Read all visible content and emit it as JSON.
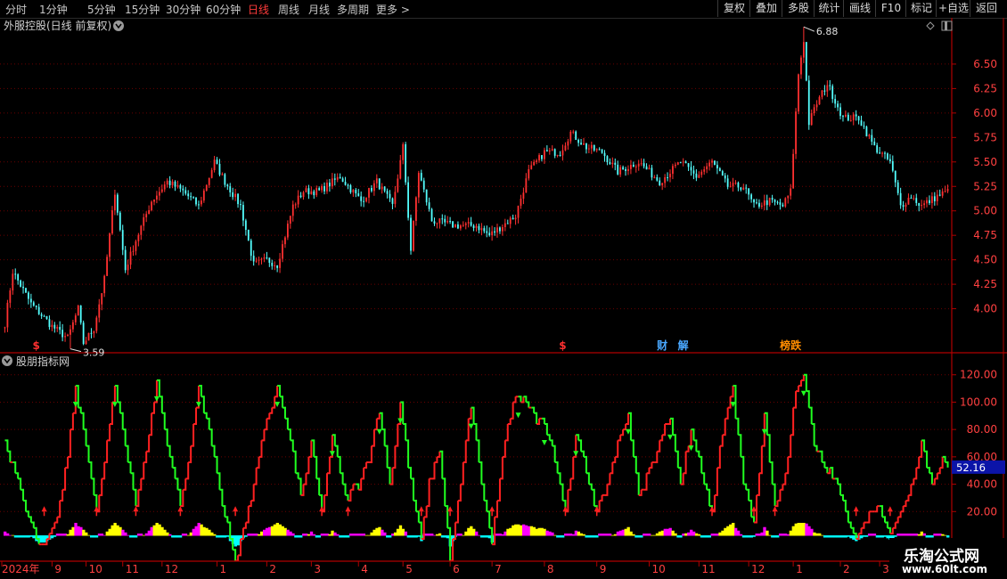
{
  "toolbar": {
    "periods": [
      "分时",
      "1分钟",
      "5分钟",
      "15分钟",
      "30分钟",
      "60分钟",
      "日线",
      "周线",
      "月线",
      "多周期",
      "更多"
    ],
    "active_period": "日线",
    "tools": [
      "复权",
      "叠加",
      "多股",
      "统计",
      "画线",
      "F10",
      "标记",
      "+自选",
      "返回"
    ]
  },
  "main_panel": {
    "title": "外服控股(日线 前复权)",
    "high_label": "6.88",
    "low_label": "3.59",
    "event_tags": [
      {
        "text": "$",
        "color": "#ff3030",
        "bar": 12
      },
      {
        "text": "$",
        "color": "#ff3030",
        "bar": 213
      },
      {
        "text": "财",
        "color": "#4aa8ff",
        "bar": 251
      },
      {
        "text": "解",
        "color": "#4aa8ff",
        "bar": 259
      },
      {
        "text": "榜跌",
        "color": "#ff8c00",
        "bar": 300
      }
    ]
  },
  "indicator_panel": {
    "title": "股朋指标网",
    "current_value": "52.16"
  },
  "date_axis": [
    "2024年",
    "9",
    "10",
    "11",
    "12",
    "1",
    "2",
    "3",
    "4",
    "5",
    "6",
    "7",
    "8",
    "9",
    "10",
    "11",
    "12",
    "1",
    "2",
    "3"
  ],
  "watermark": {
    "line1": "乐淘公式网",
    "line2": "www.60lt.com"
  },
  "colors": {
    "up": "#ff3030",
    "down": "#54ffff",
    "grid": "#6a0000",
    "axis": "#b00000",
    "ind_up": "#ff2020",
    "ind_down": "#20ff20",
    "hist_yellow": "#ffff00",
    "hist_magenta": "#ff00ff",
    "hist_cyan": "#00ffff"
  },
  "chart_data": [
    {
      "type": "candlestick",
      "title": "外服控股(日线 前复权)",
      "y_ticks": [
        4.0,
        4.25,
        4.5,
        4.75,
        5.0,
        5.25,
        5.5,
        5.75,
        6.0,
        6.25,
        6.5
      ],
      "ylim": [
        3.55,
        6.95
      ],
      "anchors": [
        {
          "bar": 0,
          "close": 3.85
        },
        {
          "bar": 3,
          "close": 4.38
        },
        {
          "bar": 10,
          "close": 4.05
        },
        {
          "bar": 18,
          "close": 3.82
        },
        {
          "bar": 24,
          "close": 3.7
        },
        {
          "bar": 28,
          "close": 4.0
        },
        {
          "bar": 30,
          "close": 3.65
        },
        {
          "bar": 34,
          "close": 3.8
        },
        {
          "bar": 38,
          "close": 4.3
        },
        {
          "bar": 42,
          "close": 5.2
        },
        {
          "bar": 46,
          "close": 4.4
        },
        {
          "bar": 50,
          "close": 4.7
        },
        {
          "bar": 56,
          "close": 5.1
        },
        {
          "bar": 62,
          "close": 5.3
        },
        {
          "bar": 68,
          "close": 5.2
        },
        {
          "bar": 74,
          "close": 5.05
        },
        {
          "bar": 80,
          "close": 5.5
        },
        {
          "bar": 84,
          "close": 5.3
        },
        {
          "bar": 90,
          "close": 5.05
        },
        {
          "bar": 95,
          "close": 4.45
        },
        {
          "bar": 100,
          "close": 4.5
        },
        {
          "bar": 104,
          "close": 4.45
        },
        {
          "bar": 110,
          "close": 5.05
        },
        {
          "bar": 114,
          "close": 5.2
        },
        {
          "bar": 120,
          "close": 5.2
        },
        {
          "bar": 128,
          "close": 5.35
        },
        {
          "bar": 136,
          "close": 5.1
        },
        {
          "bar": 142,
          "close": 5.3
        },
        {
          "bar": 148,
          "close": 5.05
        },
        {
          "bar": 152,
          "close": 5.65
        },
        {
          "bar": 155,
          "close": 4.6
        },
        {
          "bar": 158,
          "close": 5.4
        },
        {
          "bar": 163,
          "close": 4.9
        },
        {
          "bar": 172,
          "close": 4.85
        },
        {
          "bar": 180,
          "close": 4.85
        },
        {
          "bar": 185,
          "close": 4.75
        },
        {
          "bar": 190,
          "close": 4.85
        },
        {
          "bar": 195,
          "close": 4.95
        },
        {
          "bar": 200,
          "close": 5.4
        },
        {
          "bar": 206,
          "close": 5.6
        },
        {
          "bar": 212,
          "close": 5.6
        },
        {
          "bar": 216,
          "close": 5.8
        },
        {
          "bar": 222,
          "close": 5.65
        },
        {
          "bar": 228,
          "close": 5.6
        },
        {
          "bar": 234,
          "close": 5.4
        },
        {
          "bar": 242,
          "close": 5.5
        },
        {
          "bar": 250,
          "close": 5.3
        },
        {
          "bar": 258,
          "close": 5.5
        },
        {
          "bar": 264,
          "close": 5.35
        },
        {
          "bar": 270,
          "close": 5.5
        },
        {
          "bar": 276,
          "close": 5.25
        },
        {
          "bar": 282,
          "close": 5.25
        },
        {
          "bar": 286,
          "close": 5.05
        },
        {
          "bar": 292,
          "close": 5.1
        },
        {
          "bar": 297,
          "close": 5.05
        },
        {
          "bar": 300,
          "close": 5.2
        },
        {
          "bar": 303,
          "close": 6.4
        },
        {
          "bar": 305,
          "close": 6.75
        },
        {
          "bar": 307,
          "close": 5.9
        },
        {
          "bar": 310,
          "close": 6.1
        },
        {
          "bar": 314,
          "close": 6.3
        },
        {
          "bar": 320,
          "close": 5.95
        },
        {
          "bar": 326,
          "close": 5.95
        },
        {
          "bar": 332,
          "close": 5.65
        },
        {
          "bar": 338,
          "close": 5.5
        },
        {
          "bar": 342,
          "close": 5.05
        },
        {
          "bar": 346,
          "close": 5.15
        },
        {
          "bar": 350,
          "close": 5.05
        },
        {
          "bar": 356,
          "close": 5.15
        },
        {
          "bar": 360,
          "close": 5.2
        }
      ]
    },
    {
      "type": "line",
      "title": "股朋指标网",
      "y_ticks": [
        20,
        40,
        60,
        80,
        100,
        120
      ],
      "ylim": [
        -15,
        127
      ],
      "current": 52.16,
      "series": [
        {
          "color": "main-oscillator",
          "anchors": [
            {
              "bar": 0,
              "value": 70
            },
            {
              "bar": 5,
              "value": 45
            },
            {
              "bar": 9,
              "value": 15
            },
            {
              "bar": 12,
              "value": 0
            },
            {
              "bar": 16,
              "value": -3
            },
            {
              "bar": 20,
              "value": 15
            },
            {
              "bar": 24,
              "value": 60
            },
            {
              "bar": 27,
              "value": 110
            },
            {
              "bar": 32,
              "value": 60
            },
            {
              "bar": 35,
              "value": 20
            },
            {
              "bar": 38,
              "value": 55
            },
            {
              "bar": 42,
              "value": 112
            },
            {
              "bar": 46,
              "value": 70
            },
            {
              "bar": 50,
              "value": 25
            },
            {
              "bar": 53,
              "value": 55
            },
            {
              "bar": 58,
              "value": 115
            },
            {
              "bar": 62,
              "value": 70
            },
            {
              "bar": 67,
              "value": 25
            },
            {
              "bar": 70,
              "value": 55
            },
            {
              "bar": 74,
              "value": 112
            },
            {
              "bar": 79,
              "value": 70
            },
            {
              "bar": 84,
              "value": 15
            },
            {
              "bar": 88,
              "value": -15
            },
            {
              "bar": 93,
              "value": 20
            },
            {
              "bar": 98,
              "value": 70
            },
            {
              "bar": 104,
              "value": 112
            },
            {
              "bar": 108,
              "value": 80
            },
            {
              "bar": 113,
              "value": 30
            },
            {
              "bar": 117,
              "value": 70
            },
            {
              "bar": 121,
              "value": 20
            },
            {
              "bar": 125,
              "value": 75
            },
            {
              "bar": 130,
              "value": 30
            },
            {
              "bar": 135,
              "value": 40
            },
            {
              "bar": 139,
              "value": 60
            },
            {
              "bar": 143,
              "value": 95
            },
            {
              "bar": 147,
              "value": 40
            },
            {
              "bar": 151,
              "value": 100
            },
            {
              "bar": 155,
              "value": 40
            },
            {
              "bar": 159,
              "value": 0
            },
            {
              "bar": 162,
              "value": 40
            },
            {
              "bar": 166,
              "value": 65
            },
            {
              "bar": 170,
              "value": -15
            },
            {
              "bar": 174,
              "value": 40
            },
            {
              "bar": 178,
              "value": 100
            },
            {
              "bar": 182,
              "value": 40
            },
            {
              "bar": 186,
              "value": -2
            },
            {
              "bar": 190,
              "value": 60
            },
            {
              "bar": 194,
              "value": 100
            },
            {
              "bar": 198,
              "value": 105
            },
            {
              "bar": 202,
              "value": 90
            },
            {
              "bar": 206,
              "value": 85
            },
            {
              "bar": 210,
              "value": 60
            },
            {
              "bar": 214,
              "value": 20
            },
            {
              "bar": 218,
              "value": 75
            },
            {
              "bar": 222,
              "value": 50
            },
            {
              "bar": 226,
              "value": 20
            },
            {
              "bar": 230,
              "value": 40
            },
            {
              "bar": 234,
              "value": 70
            },
            {
              "bar": 238,
              "value": 90
            },
            {
              "bar": 242,
              "value": 30
            },
            {
              "bar": 246,
              "value": 50
            },
            {
              "bar": 250,
              "value": 70
            },
            {
              "bar": 254,
              "value": 90
            },
            {
              "bar": 258,
              "value": 40
            },
            {
              "bar": 262,
              "value": 80
            },
            {
              "bar": 266,
              "value": 50
            },
            {
              "bar": 270,
              "value": 20
            },
            {
              "bar": 274,
              "value": 80
            },
            {
              "bar": 278,
              "value": 110
            },
            {
              "bar": 282,
              "value": 40
            },
            {
              "bar": 286,
              "value": 10
            },
            {
              "bar": 290,
              "value": 90
            },
            {
              "bar": 294,
              "value": 20
            },
            {
              "bar": 298,
              "value": 50
            },
            {
              "bar": 302,
              "value": 105
            },
            {
              "bar": 305,
              "value": 120
            },
            {
              "bar": 309,
              "value": 70
            },
            {
              "bar": 313,
              "value": 50
            },
            {
              "bar": 317,
              "value": 45
            },
            {
              "bar": 321,
              "value": 20
            },
            {
              "bar": 325,
              "value": 0
            },
            {
              "bar": 330,
              "value": 20
            },
            {
              "bar": 334,
              "value": 25
            },
            {
              "bar": 338,
              "value": 5
            },
            {
              "bar": 342,
              "value": 20
            },
            {
              "bar": 346,
              "value": 40
            },
            {
              "bar": 350,
              "value": 70
            },
            {
              "bar": 354,
              "value": 40
            },
            {
              "bar": 358,
              "value": 60
            },
            {
              "bar": 360,
              "value": 52
            }
          ]
        }
      ]
    }
  ]
}
